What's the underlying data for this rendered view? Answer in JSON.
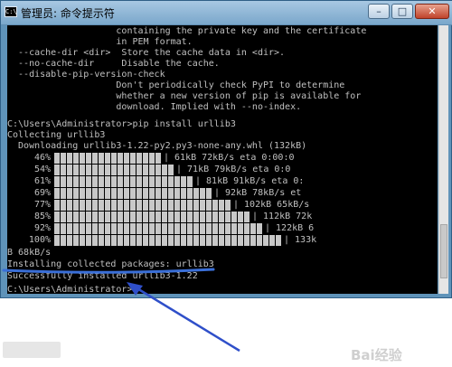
{
  "window": {
    "title": "管理员: 命令提示符",
    "icon_text": "C:\\",
    "buttons": {
      "minimize": "–",
      "maximize": "□",
      "close": "✕"
    }
  },
  "console": {
    "lines": [
      "                    containing the private key and the certificate",
      "                    in PEM format.",
      "  --cache-dir <dir>  Store the cache data in <dir>.",
      "  --no-cache-dir     Disable the cache.",
      "  --disable-pip-version-check",
      "                    Don't periodically check PyPI to determine",
      "                    whether a new version of pip is available for",
      "                    download. Implied with --no-index.",
      "",
      "C:\\Users\\Administrator>pip install urllib3",
      "Collecting urllib3",
      "  Downloading urllib3-1.22-py2.py3-none-any.whl (132kB)"
    ],
    "progress": [
      {
        "pct": "46%",
        "fill": 0.46,
        "tail": "| 61kB 72kB/s eta 0:00:0"
      },
      {
        "pct": "54%",
        "fill": 0.54,
        "tail": "| 71kB 79kB/s eta 0:0"
      },
      {
        "pct": "61%",
        "fill": 0.61,
        "tail": "| 81kB 91kB/s eta 0:"
      },
      {
        "pct": "69%",
        "fill": 0.69,
        "tail": "| 92kB 78kB/s et"
      },
      {
        "pct": "77%",
        "fill": 0.77,
        "tail": "| 102kB 65kB/s"
      },
      {
        "pct": "85%",
        "fill": 0.85,
        "tail": "| 112kB 72k"
      },
      {
        "pct": "92%",
        "fill": 0.92,
        "tail": "| 122kB 6"
      },
      {
        "pct": "100%",
        "fill": 1.0,
        "tail": "| 133k"
      }
    ],
    "after_lines": [
      "B 68kB/s",
      "Installing collected packages: urllib3",
      "Successfully installed urllib3-1.22",
      "",
      "C:\\Users\\Administrator>"
    ]
  },
  "annotation": {
    "underline_color": "#3a6fd8",
    "arrow_color": "#2f4fc9"
  },
  "watermark": "Bai经验"
}
